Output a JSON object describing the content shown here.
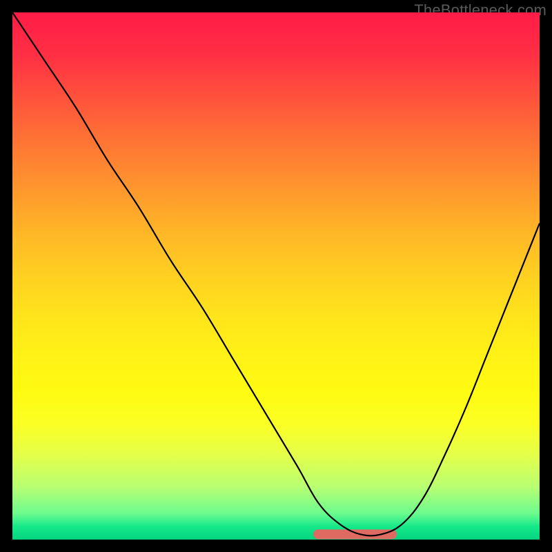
{
  "watermark": "TheBottleneck.com",
  "chart_data": {
    "type": "line",
    "title": "",
    "xlabel": "",
    "ylabel": "",
    "xlim": [
      0,
      100
    ],
    "ylim": [
      0,
      100
    ],
    "grid": false,
    "legend": false,
    "series": [
      {
        "name": "curve",
        "color": "#000000",
        "x": [
          0,
          6,
          12,
          18,
          24,
          30,
          36,
          42,
          48,
          54,
          58,
          62,
          66,
          70,
          74,
          78,
          82,
          86,
          90,
          94,
          98,
          100
        ],
        "values": [
          100,
          91,
          82,
          72,
          63,
          53,
          44,
          34,
          24,
          14,
          7,
          3,
          1,
          1,
          3,
          8,
          16,
          25,
          35,
          45,
          55,
          60
        ]
      },
      {
        "name": "trough-highlight",
        "color": "#df6a62",
        "x": [
          58,
          62,
          66,
          70,
          72
        ],
        "values": [
          1,
          1,
          1,
          1,
          1
        ]
      }
    ]
  }
}
